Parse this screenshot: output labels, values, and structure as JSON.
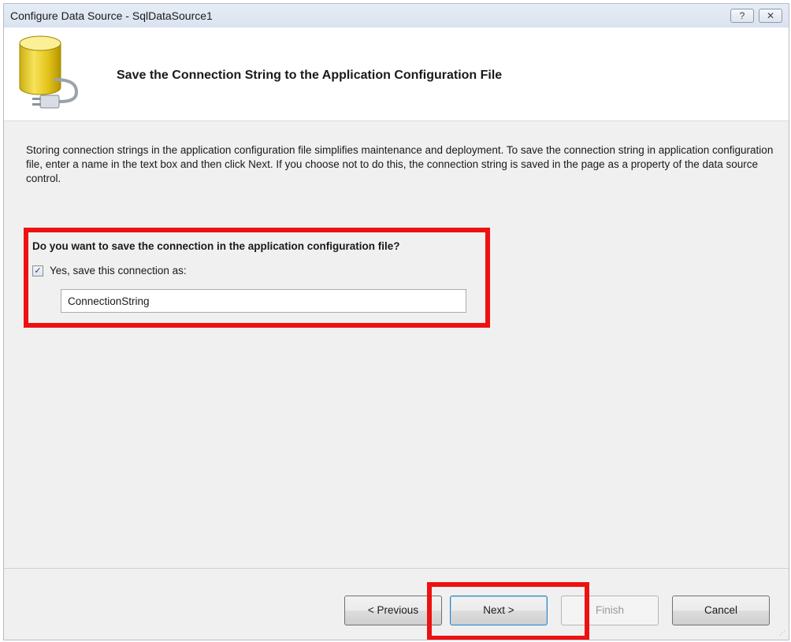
{
  "window": {
    "title": "Configure Data Source - SqlDataSource1",
    "help_label": "?",
    "close_label": "✕"
  },
  "header": {
    "heading": "Save the Connection String to the Application Configuration File",
    "icon": "database-plug-icon"
  },
  "description": "Storing connection strings in the application configuration file simplifies maintenance and deployment. To save the connection string in application configuration file, enter a name in the text box and then click Next. If you choose not to do this, the connection string is saved in the page as a property of the data source control.",
  "save_section": {
    "question": "Do you want to save the connection in the application configuration file?",
    "checkbox_label": "Yes, save this connection as:",
    "checkbox_checked": true,
    "checkbox_mark": "✓",
    "connection_name": "ConnectionString"
  },
  "buttons": {
    "previous": "< Previous",
    "next": "Next >",
    "finish": "Finish",
    "cancel": "Cancel"
  },
  "colors": {
    "highlight": "#ee1111"
  }
}
